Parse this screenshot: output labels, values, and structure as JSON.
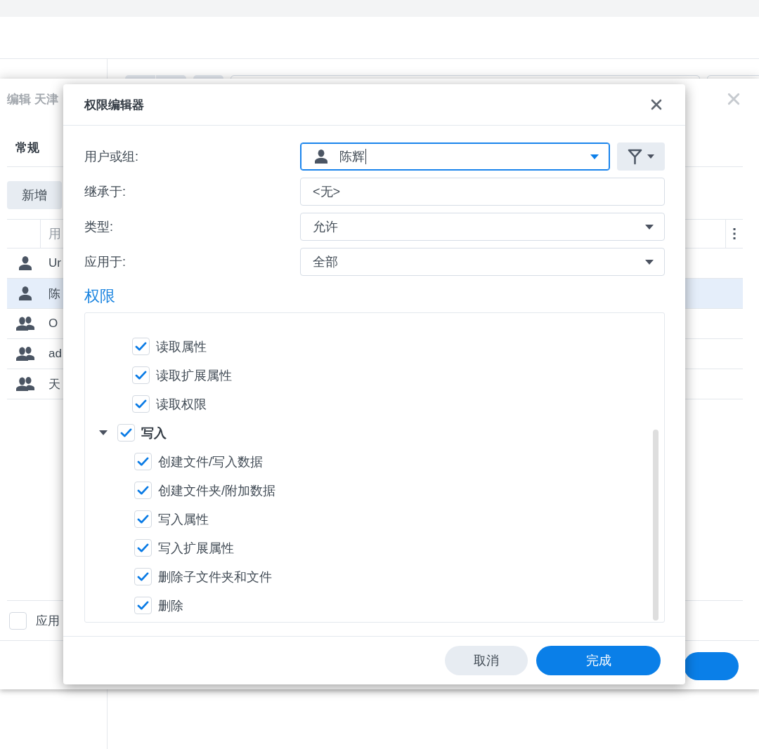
{
  "background_window": {
    "title": "编辑 天津",
    "tabs": [
      {
        "label": "常规",
        "selected": true
      }
    ],
    "add_button": "新增",
    "table": {
      "columns": [
        "用"
      ],
      "rows": [
        {
          "kind": "user",
          "name": "Ur",
          "selected": false
        },
        {
          "kind": "user",
          "name": "陈",
          "selected": true
        },
        {
          "kind": "group",
          "name": "O",
          "selected": false
        },
        {
          "kind": "group",
          "name": "ad",
          "selected": false
        },
        {
          "kind": "group",
          "name": "天",
          "selected": false
        }
      ]
    },
    "apply_option": {
      "label": "应用",
      "checked": false
    }
  },
  "dialog": {
    "title": "权限编辑器",
    "fields": [
      {
        "kind": "user_select",
        "label": "用户或组:",
        "value": "陈辉",
        "focused": true
      },
      {
        "kind": "text",
        "label": "继承于:",
        "value": "<无>",
        "focused": false
      },
      {
        "kind": "select",
        "label": "类型:",
        "value": "允许",
        "focused": false
      },
      {
        "kind": "select",
        "label": "应用于:",
        "value": "全部",
        "focused": false
      }
    ],
    "section_title": "权限",
    "permissions": {
      "continued_items": [
        {
          "label": "读取属性",
          "checked": true
        },
        {
          "label": "读取扩展属性",
          "checked": true
        },
        {
          "label": "读取权限",
          "checked": true
        }
      ],
      "groups": [
        {
          "label": "写入",
          "checked": true,
          "expanded": true,
          "children": [
            {
              "label": "创建文件/写入数据",
              "checked": true
            },
            {
              "label": "创建文件夹/附加数据",
              "checked": true
            },
            {
              "label": "写入属性",
              "checked": true
            },
            {
              "label": "写入扩展属性",
              "checked": true
            },
            {
              "label": "删除子文件夹和文件",
              "checked": true
            },
            {
              "label": "删除",
              "checked": true
            }
          ]
        }
      ]
    },
    "buttons": [
      {
        "kind": "secondary",
        "label": "取消"
      },
      {
        "kind": "primary",
        "label": "完成"
      }
    ]
  }
}
